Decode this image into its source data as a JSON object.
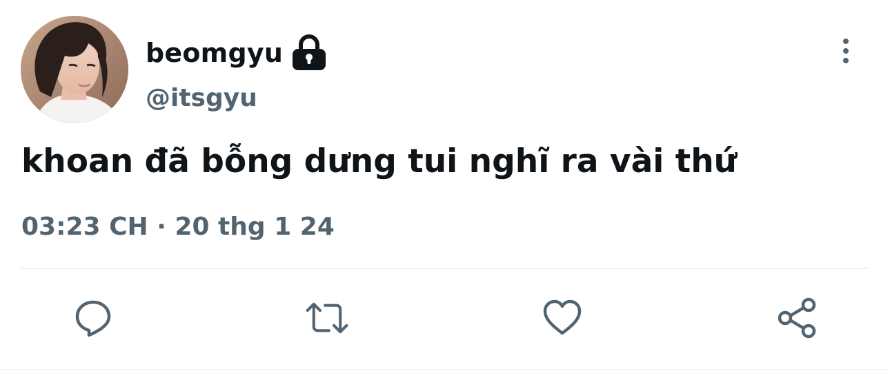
{
  "user": {
    "display_name": "beomgyu",
    "handle": "@itsgyu",
    "protected": true
  },
  "tweet": {
    "text": "khoan đã bỗng dưng tui nghĩ ra vài thứ",
    "timestamp": "03:23 CH · 20 thg 1 24"
  },
  "actions": [
    {
      "name": "reply",
      "icon": "comment-icon"
    },
    {
      "name": "retweet",
      "icon": "retweet-icon"
    },
    {
      "name": "like",
      "icon": "heart-icon"
    },
    {
      "name": "share",
      "icon": "share-icon"
    }
  ],
  "colors": {
    "text_primary": "#0f1419",
    "text_secondary": "#536471",
    "divider": "#eff3f4",
    "background": "#ffffff"
  }
}
